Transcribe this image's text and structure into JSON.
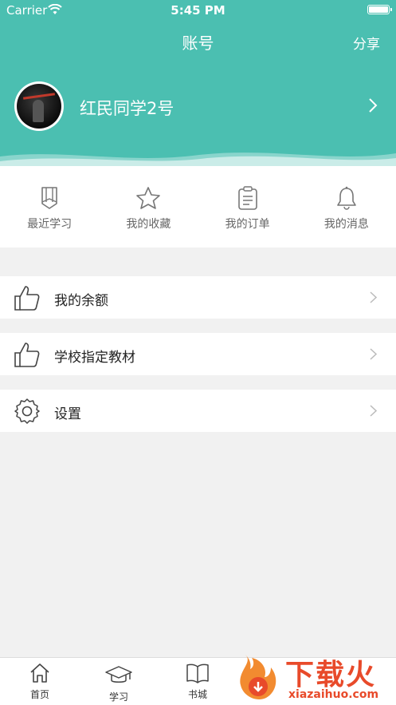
{
  "status_bar": {
    "carrier": "Carrier",
    "time": "5:45 PM"
  },
  "header": {
    "title": "账号",
    "share_label": "分享",
    "username": "红民同学2号",
    "background_color": "#4bbfb1"
  },
  "quick_actions": [
    {
      "icon": "pencil-icon",
      "label": "最近学习"
    },
    {
      "icon": "star-icon",
      "label": "我的收藏"
    },
    {
      "icon": "clipboard-icon",
      "label": "我的订单"
    },
    {
      "icon": "bell-icon",
      "label": "我的消息"
    }
  ],
  "menu": [
    {
      "icon": "thumbs-up-icon",
      "label": "我的余额"
    },
    {
      "icon": "thumbs-up-icon",
      "label": "学校指定教材"
    },
    {
      "icon": "gear-icon",
      "label": "设置"
    }
  ],
  "tabbar": [
    {
      "icon": "home-icon",
      "label": "首页"
    },
    {
      "icon": "graduation-cap-icon",
      "label": "学习"
    },
    {
      "icon": "book-icon",
      "label": "书城"
    }
  ],
  "watermark": {
    "text": "下载火",
    "subtext": "xiazaihuo.com",
    "color": "#e84a2a"
  }
}
